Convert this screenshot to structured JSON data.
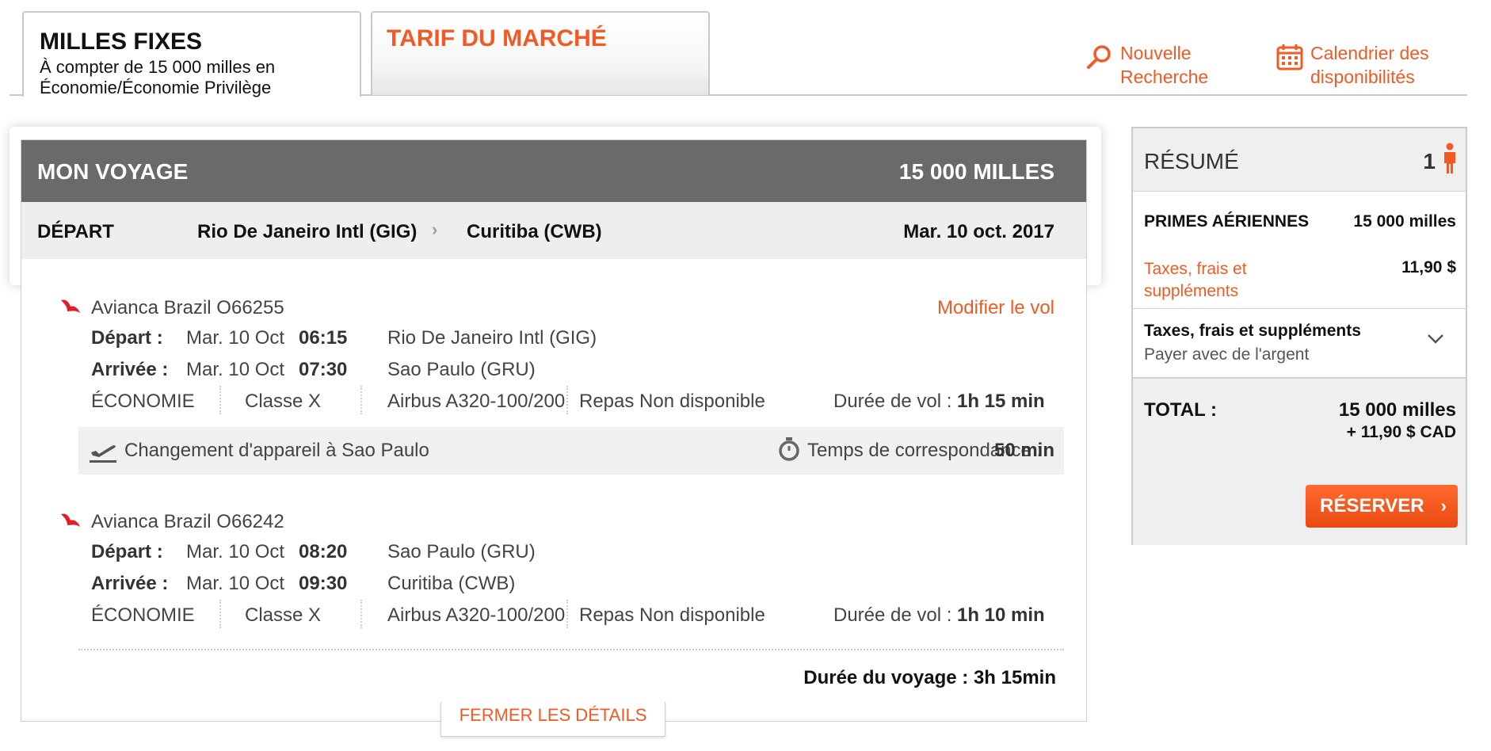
{
  "tabs": {
    "fixed": {
      "title": "MILLES FIXES",
      "line1": "À compter de  15 000 milles en",
      "line2": "Économie/Économie Privilège"
    },
    "market": {
      "title": "TARIF DU MARCHÉ"
    }
  },
  "links": {
    "search": {
      "line1": "Nouvelle",
      "line2": "Recherche",
      "icon": "search-icon"
    },
    "calendar": {
      "line1": "Calendrier des",
      "line2": "disponibilités",
      "icon": "calendar-icon"
    }
  },
  "trip": {
    "title": "MON VOYAGE",
    "miles": "15 000 MILLES",
    "departure_label": "DÉPART",
    "origin": "Rio De Janeiro Intl (GIG)",
    "destination": "Curitiba (CWB)",
    "date": "Mar. 10 oct. 2017",
    "modify_label": "Modifier le vol",
    "segments": [
      {
        "airline": "Avianca Brazil O66255",
        "dep_label": "Départ :",
        "dep_date": "Mar. 10 Oct",
        "dep_time": "06:15",
        "dep_airport": "Rio De Janeiro Intl (GIG)",
        "arr_label": "Arrivée :",
        "arr_date": "Mar. 10 Oct",
        "arr_time": "07:30",
        "arr_airport": "Sao Paulo (GRU)",
        "cabin": "ÉCONOMIE",
        "class": "Classe X",
        "aircraft": "Airbus A320-100/200",
        "meal": "Repas Non disponible",
        "duration_label": "Durée de vol :",
        "duration": "1h 15 min"
      },
      {
        "airline": "Avianca Brazil O66242",
        "dep_label": "Départ :",
        "dep_date": "Mar. 10 Oct",
        "dep_time": "08:20",
        "dep_airport": "Sao Paulo (GRU)",
        "arr_label": "Arrivée :",
        "arr_date": "Mar. 10 Oct",
        "arr_time": "09:30",
        "arr_airport": "Curitiba (CWB)",
        "cabin": "ÉCONOMIE",
        "class": "Classe X",
        "aircraft": "Airbus A320-100/200",
        "meal": "Repas Non disponible",
        "duration_label": "Durée de vol :",
        "duration": "1h 10 min"
      }
    ],
    "connection": {
      "text": "Changement d'appareil à Sao Paulo",
      "time_label": "Temps de correspondance :",
      "time": "50 min"
    },
    "total_duration": "Durée du voyage : 3h 15min",
    "close_details": "FERMER LES DÉTAILS"
  },
  "summary": {
    "title": "RÉSUMÉ",
    "passengers": "1",
    "awards_label": "PRIMES AÉRIENNES",
    "awards_value": "15 000 milles",
    "taxes_label": "Taxes, frais et suppléments",
    "taxes_value": "11,90 $",
    "taxes_section_title": "Taxes, frais et suppléments",
    "taxes_section_sub": "Payer avec de l'argent",
    "total_label": "TOTAL :",
    "total_miles": "15 000  milles",
    "total_cash": "+ 11,90 $ CAD",
    "reserve_label": "RÉSERVER"
  },
  "colors": {
    "accent": "#f15a24",
    "header": "#6a6a6a",
    "panel": "#efefef"
  }
}
